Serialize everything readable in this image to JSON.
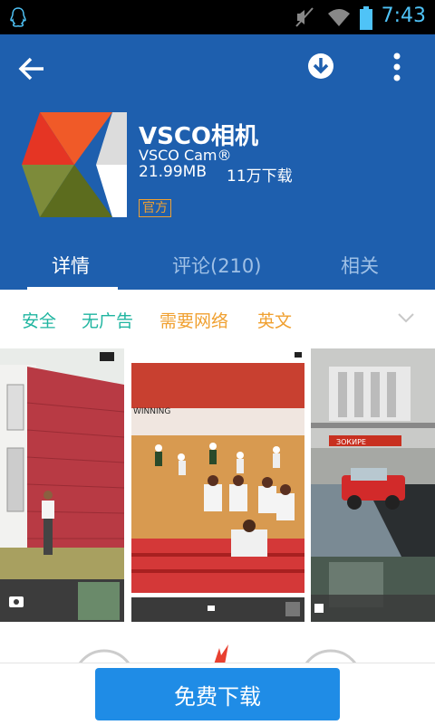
{
  "status_bar": {
    "time": "7:43"
  },
  "app": {
    "name": "VSCO相机",
    "subtitle": "VSCO Cam®",
    "size": "21.99MB",
    "downloads": "11万下载",
    "official_badge": "官方"
  },
  "tabs": [
    {
      "label": "详情",
      "active": true
    },
    {
      "label": "评论(210)",
      "active": false
    },
    {
      "label": "相关",
      "active": false
    }
  ],
  "tags": [
    {
      "label": "安全",
      "color": "#1fb5a0"
    },
    {
      "label": "无广告",
      "color": "#1fb5a0"
    },
    {
      "label": "需要网络",
      "color": "#f0a030"
    },
    {
      "label": "英文",
      "color": "#f0a030"
    }
  ],
  "screenshots": [
    {
      "name": "red-house-photo",
      "banner_text": ""
    },
    {
      "name": "basketball-court-photo",
      "banner_text": "WINNING"
    },
    {
      "name": "red-car-street-photo",
      "banner_text": "ЗОКИРЕ"
    }
  ],
  "download_button": {
    "label": "免费下载"
  },
  "colors": {
    "header": "#1e5fae",
    "accent": "#1f8ce6",
    "tab_inactive": "#9fc0e6"
  }
}
